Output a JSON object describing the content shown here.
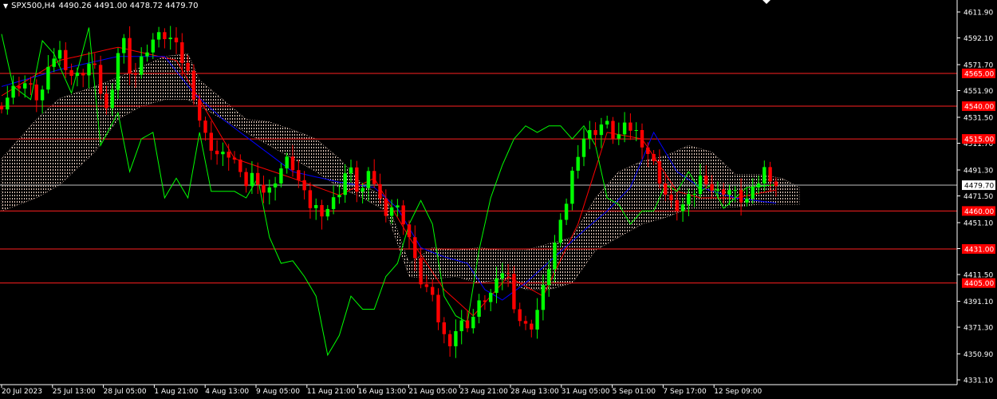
{
  "header": {
    "symbol": "SPX500,H4",
    "ohlc": "4490.26 4491.00 4478.72 4479.70"
  },
  "chart_data": {
    "type": "candlestick",
    "symbol": "SPX500",
    "timeframe": "H4",
    "ylim": [
      4331.1,
      4621.0
    ],
    "y_ticks": [
      4611.9,
      4592.1,
      4571.7,
      4551.9,
      4531.5,
      4511.7,
      4491.3,
      4471.5,
      4451.1,
      4431.3,
      4411.5,
      4391.1,
      4371.3,
      4350.9,
      4331.1
    ],
    "x_ticks": [
      "20 Jul 2023",
      "25 Jul 13:00",
      "28 Jul 05:00",
      "1 Aug 21:00",
      "4 Aug 13:00",
      "9 Aug 05:00",
      "11 Aug 21:00",
      "16 Aug 13:00",
      "21 Aug 05:00",
      "23 Aug 21:00",
      "28 Aug 13:00",
      "31 Aug 05:00",
      "5 Sep 01:00",
      "7 Sep 17:00",
      "12 Sep 09:00"
    ],
    "horizontal_levels": [
      {
        "label": "4565.00",
        "value": 4565.0
      },
      {
        "label": "4540.00",
        "value": 4540.0
      },
      {
        "label": "4515.00",
        "value": 4515.0
      },
      {
        "label": "4460.00",
        "value": 4460.0
      },
      {
        "label": "4431.00",
        "value": 4431.0
      },
      {
        "label": "4405.00",
        "value": 4405.0
      }
    ],
    "current_price": {
      "label": "4479.70",
      "value": 4479.7
    },
    "price_path": [
      [
        0,
        4540
      ],
      [
        4,
        4560
      ],
      [
        7,
        4545
      ],
      [
        10,
        4585
      ],
      [
        13,
        4560
      ],
      [
        16,
        4575
      ],
      [
        19,
        4530
      ],
      [
        21,
        4600
      ],
      [
        23,
        4560
      ],
      [
        26,
        4590
      ],
      [
        29,
        4595
      ],
      [
        31,
        4580
      ],
      [
        33,
        4560
      ],
      [
        35,
        4520
      ],
      [
        38,
        4500
      ],
      [
        40,
        4505
      ],
      [
        42,
        4478
      ],
      [
        44,
        4490
      ],
      [
        46,
        4470
      ],
      [
        48,
        4490
      ],
      [
        50,
        4500
      ],
      [
        53,
        4465
      ],
      [
        56,
        4460
      ],
      [
        58,
        4470
      ],
      [
        60,
        4495
      ],
      [
        62,
        4472
      ],
      [
        64,
        4490
      ],
      [
        66,
        4460
      ],
      [
        68,
        4465
      ],
      [
        70,
        4450
      ],
      [
        72,
        4410
      ],
      [
        74,
        4398
      ],
      [
        76,
        4370
      ],
      [
        77,
        4358
      ],
      [
        79,
        4373
      ],
      [
        81,
        4375
      ],
      [
        83,
        4392
      ],
      [
        85,
        4398
      ],
      [
        87,
        4420
      ],
      [
        89,
        4380
      ],
      [
        91,
        4368
      ],
      [
        93,
        4390
      ],
      [
        95,
        4428
      ],
      [
        97,
        4455
      ],
      [
        98,
        4480
      ],
      [
        100,
        4515
      ],
      [
        102,
        4520
      ],
      [
        104,
        4528
      ],
      [
        106,
        4515
      ],
      [
        108,
        4525
      ],
      [
        110,
        4518
      ],
      [
        112,
        4500
      ],
      [
        114,
        4480
      ],
      [
        115,
        4465
      ],
      [
        117,
        4462
      ],
      [
        119,
        4470
      ],
      [
        121,
        4490
      ],
      [
        123,
        4472
      ],
      [
        125,
        4478
      ],
      [
        127,
        4470
      ],
      [
        129,
        4468
      ],
      [
        131,
        4488
      ],
      [
        132,
        4495
      ],
      [
        133,
        4480
      ]
    ],
    "series": [
      {
        "name": "",
        "color": "#ff0000",
        "points": [
          [
            0,
            4548
          ],
          [
            10,
            4575
          ],
          [
            20,
            4585
          ],
          [
            30,
            4575
          ],
          [
            40,
            4500
          ],
          [
            50,
            4485
          ],
          [
            58,
            4472
          ],
          [
            64,
            4485
          ],
          [
            70,
            4440
          ],
          [
            76,
            4400
          ],
          [
            81,
            4380
          ],
          [
            87,
            4410
          ],
          [
            93,
            4395
          ],
          [
            99,
            4450
          ],
          [
            104,
            4520
          ],
          [
            110,
            4515
          ],
          [
            116,
            4475
          ],
          [
            120,
            4470
          ],
          [
            126,
            4470
          ],
          [
            133,
            4476
          ]
        ]
      },
      {
        "name": "",
        "color": "#0000ff",
        "points": [
          [
            0,
            4555
          ],
          [
            10,
            4568
          ],
          [
            20,
            4578
          ],
          [
            28,
            4578
          ],
          [
            33,
            4550
          ],
          [
            38,
            4530
          ],
          [
            44,
            4510
          ],
          [
            50,
            4490
          ],
          [
            58,
            4482
          ],
          [
            64,
            4478
          ],
          [
            68,
            4462
          ],
          [
            72,
            4432
          ],
          [
            76,
            4425
          ],
          [
            80,
            4420
          ],
          [
            83,
            4400
          ],
          [
            86,
            4392
          ],
          [
            90,
            4405
          ],
          [
            95,
            4425
          ],
          [
            100,
            4445
          ],
          [
            104,
            4460
          ],
          [
            108,
            4478
          ],
          [
            112,
            4520
          ],
          [
            116,
            4490
          ],
          [
            120,
            4478
          ],
          [
            126,
            4470
          ],
          [
            133,
            4466
          ]
        ]
      },
      {
        "name": "",
        "color": "#00ff00",
        "points": [
          [
            0,
            4595
          ],
          [
            2,
            4555
          ],
          [
            5,
            4545
          ],
          [
            7,
            4590
          ],
          [
            9,
            4580
          ],
          [
            12,
            4550
          ],
          [
            15,
            4600
          ],
          [
            17,
            4510
          ],
          [
            20,
            4535
          ],
          [
            22,
            4490
          ],
          [
            24,
            4515
          ],
          [
            26,
            4520
          ],
          [
            28,
            4470
          ],
          [
            30,
            4485
          ],
          [
            32,
            4470
          ],
          [
            34,
            4520
          ],
          [
            36,
            4475
          ],
          [
            38,
            4475
          ],
          [
            40,
            4475
          ],
          [
            42,
            4470
          ],
          [
            44,
            4485
          ],
          [
            46,
            4440
          ],
          [
            48,
            4420
          ],
          [
            50,
            4422
          ],
          [
            52,
            4410
          ],
          [
            54,
            4395
          ],
          [
            56,
            4350
          ],
          [
            58,
            4365
          ],
          [
            60,
            4395
          ],
          [
            62,
            4385
          ],
          [
            64,
            4385
          ],
          [
            66,
            4410
          ],
          [
            68,
            4420
          ],
          [
            70,
            4450
          ],
          [
            72,
            4468
          ],
          [
            74,
            4450
          ],
          [
            76,
            4395
          ],
          [
            78,
            4380
          ],
          [
            80,
            4375
          ],
          [
            82,
            4430
          ],
          [
            84,
            4470
          ],
          [
            86,
            4495
          ],
          [
            88,
            4515
          ],
          [
            90,
            4525
          ],
          [
            92,
            4520
          ],
          [
            94,
            4525
          ],
          [
            96,
            4525
          ],
          [
            98,
            4515
          ],
          [
            100,
            4525
          ],
          [
            102,
            4510
          ],
          [
            104,
            4470
          ],
          [
            106,
            4465
          ],
          [
            108,
            4450
          ],
          [
            110,
            4460
          ],
          [
            112,
            4460
          ],
          [
            114,
            4480
          ],
          [
            116,
            4475
          ],
          [
            118,
            4490
          ],
          [
            120,
            4475
          ],
          [
            122,
            4480
          ],
          [
            124,
            4462
          ],
          [
            126,
            4470
          ],
          [
            128,
            4478
          ],
          [
            133,
            4480
          ]
        ]
      }
    ],
    "cloud": {
      "upper": [
        [
          0,
          4500
        ],
        [
          6,
          4530
        ],
        [
          10,
          4546
        ],
        [
          16,
          4555
        ],
        [
          20,
          4562
        ],
        [
          24,
          4570
        ],
        [
          28,
          4578
        ],
        [
          32,
          4580
        ],
        [
          34,
          4560
        ],
        [
          38,
          4545
        ],
        [
          42,
          4530
        ],
        [
          46,
          4528
        ],
        [
          50,
          4522
        ],
        [
          54,
          4515
        ],
        [
          58,
          4500
        ],
        [
          62,
          4480
        ],
        [
          66,
          4470
        ],
        [
          70,
          4420
        ],
        [
          74,
          4432
        ],
        [
          78,
          4430
        ],
        [
          82,
          4432
        ],
        [
          86,
          4430
        ],
        [
          90,
          4430
        ],
        [
          94,
          4435
        ],
        [
          98,
          4440
        ],
        [
          102,
          4470
        ],
        [
          106,
          4490
        ],
        [
          110,
          4498
        ],
        [
          114,
          4502
        ],
        [
          118,
          4510
        ],
        [
          122,
          4505
        ],
        [
          126,
          4488
        ],
        [
          130,
          4488
        ],
        [
          134,
          4485
        ],
        [
          137,
          4478
        ]
      ],
      "lower": [
        [
          0,
          4460
        ],
        [
          6,
          4470
        ],
        [
          10,
          4480
        ],
        [
          16,
          4505
        ],
        [
          20,
          4530
        ],
        [
          24,
          4540
        ],
        [
          28,
          4545
        ],
        [
          32,
          4545
        ],
        [
          34,
          4540
        ],
        [
          38,
          4530
        ],
        [
          42,
          4520
        ],
        [
          46,
          4510
        ],
        [
          50,
          4500
        ],
        [
          54,
          4490
        ],
        [
          58,
          4478
        ],
        [
          62,
          4470
        ],
        [
          66,
          4460
        ],
        [
          70,
          4410
        ],
        [
          74,
          4408
        ],
        [
          78,
          4410
        ],
        [
          82,
          4405
        ],
        [
          86,
          4408
        ],
        [
          90,
          4400
        ],
        [
          94,
          4400
        ],
        [
          98,
          4405
        ],
        [
          102,
          4430
        ],
        [
          106,
          4440
        ],
        [
          110,
          4450
        ],
        [
          114,
          4455
        ],
        [
          118,
          4462
        ],
        [
          122,
          4462
        ],
        [
          126,
          4463
        ],
        [
          130,
          4465
        ],
        [
          134,
          4465
        ],
        [
          137,
          4465
        ]
      ]
    }
  }
}
